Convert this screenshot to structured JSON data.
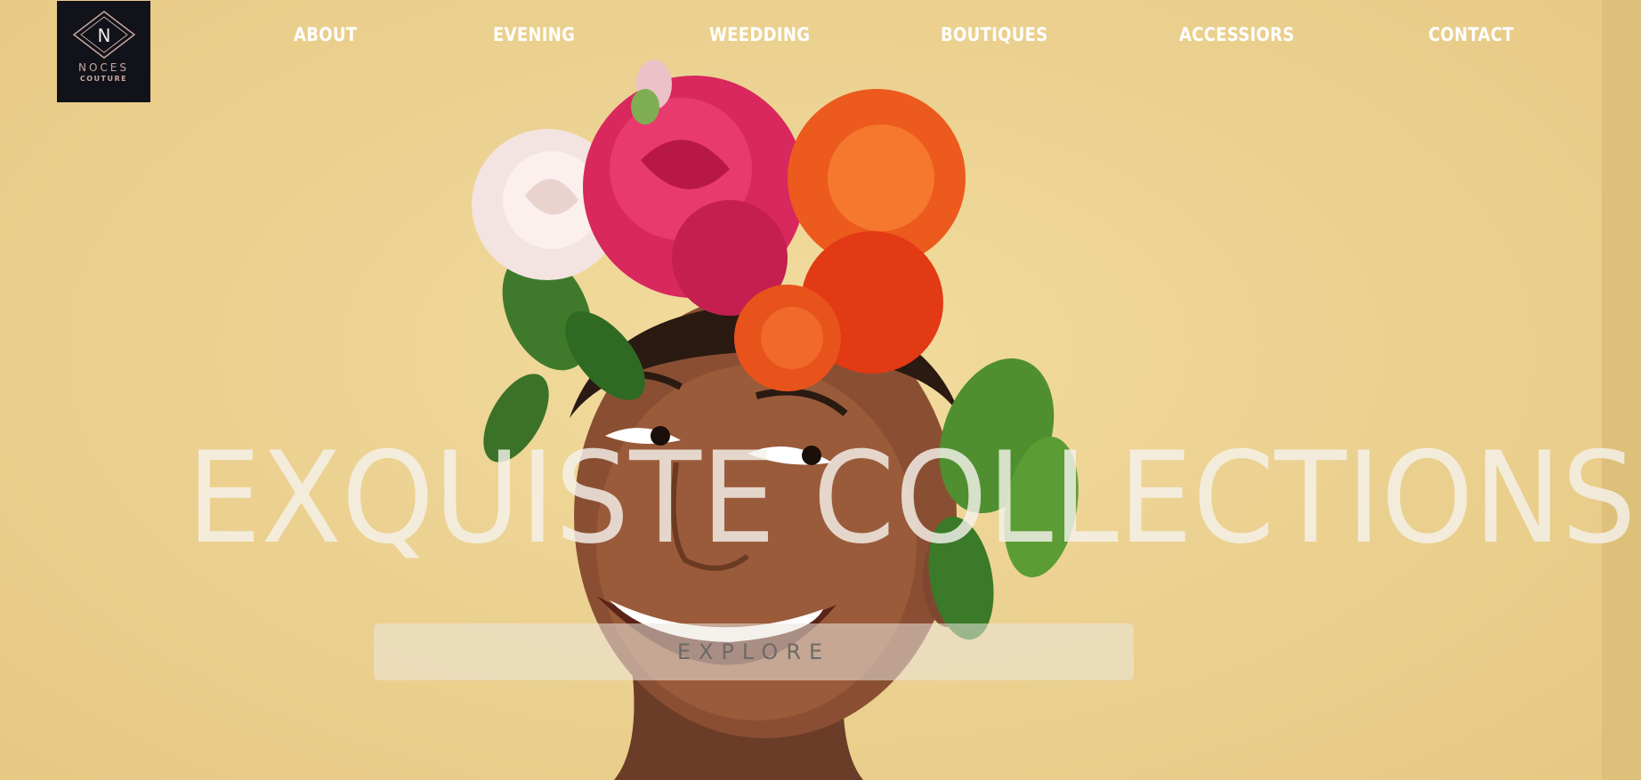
{
  "brand": {
    "logo_letter": "N",
    "logo_line1": "NOCES",
    "logo_line2": "COUTURE",
    "logo_bg": "#11121a",
    "logo_accent": "#c9a79e"
  },
  "nav": {
    "items": [
      {
        "label": "ABOUT"
      },
      {
        "label": "EVENING"
      },
      {
        "label": "WEEDDING"
      },
      {
        "label": "BOUTIQUES"
      },
      {
        "label": "ACCESSIORS"
      },
      {
        "label": "CONTACT"
      }
    ]
  },
  "hero": {
    "headline": "EXQUISTE COLLECTIONS",
    "cta_label": "EXPLORE",
    "background_color": "#e9d08e",
    "image_subject": "smiling woman wearing a flower crown of white, pink and orange roses"
  }
}
